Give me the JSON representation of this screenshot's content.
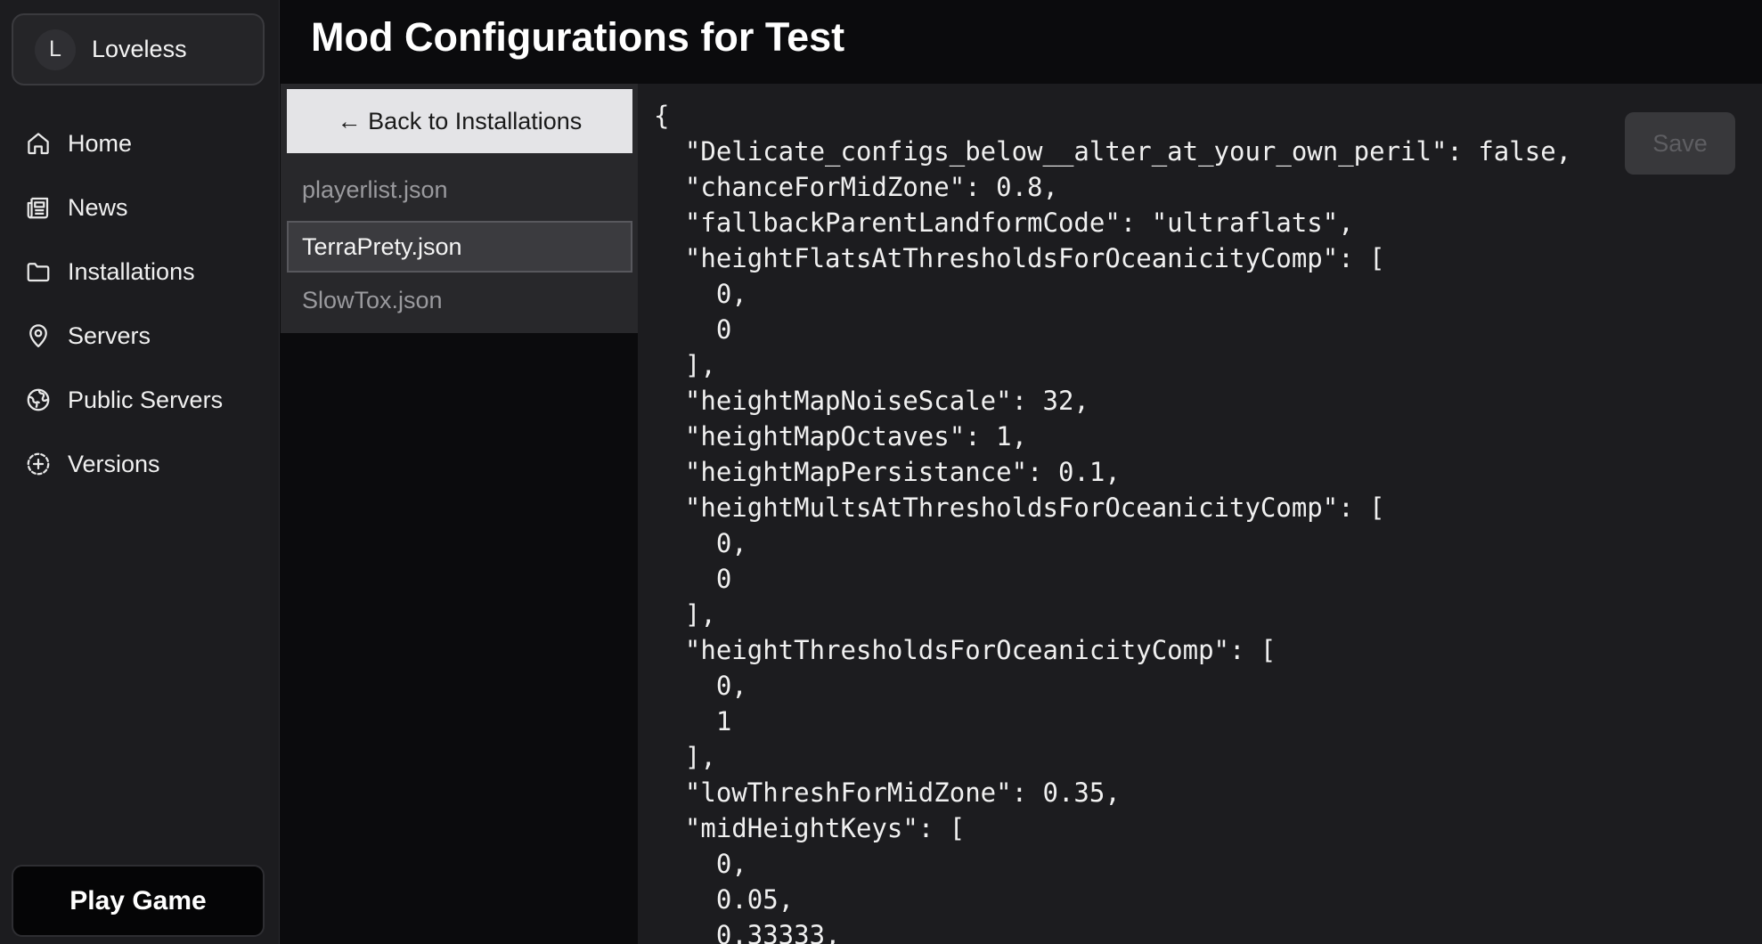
{
  "user": {
    "initial": "L",
    "name": "Loveless"
  },
  "nav": [
    {
      "label": "Home",
      "icon": "home-icon"
    },
    {
      "label": "News",
      "icon": "news-icon"
    },
    {
      "label": "Installations",
      "icon": "folder-icon"
    },
    {
      "label": "Servers",
      "icon": "map-pin-icon"
    },
    {
      "label": "Public Servers",
      "icon": "globe-icon"
    },
    {
      "label": "Versions",
      "icon": "plus-circle-icon"
    }
  ],
  "play_button": "Play Game",
  "page_title": "Mod Configurations for Test",
  "back_button": "← Back to Installations",
  "files": [
    "playerlist.json",
    "TerraPrety.json",
    "SlowTox.json"
  ],
  "active_file": "TerraPrety.json",
  "save_button": "Save",
  "editor_content": "{\n  \"Delicate_configs_below__alter_at_your_own_peril\": false,\n  \"chanceForMidZone\": 0.8,\n  \"fallbackParentLandformCode\": \"ultraflats\",\n  \"heightFlatsAtThresholdsForOceanicityComp\": [\n    0,\n    0\n  ],\n  \"heightMapNoiseScale\": 32,\n  \"heightMapOctaves\": 1,\n  \"heightMapPersistance\": 0.1,\n  \"heightMultsAtThresholdsForOceanicityComp\": [\n    0,\n    0\n  ],\n  \"heightThresholdsForOceanicityComp\": [\n    0,\n    1\n  ],\n  \"lowThreshForMidZone\": 0.35,\n  \"midHeightKeys\": [\n    0,\n    0.05,\n    0.33333,",
  "colors": {
    "sidebar_bg": "#1c1c1f",
    "page_bg": "#0b0b0d",
    "editor_bg": "#1c1c1f",
    "back_button_bg": "#e4e4e7",
    "active_file_bg": "#3b3b3f"
  }
}
